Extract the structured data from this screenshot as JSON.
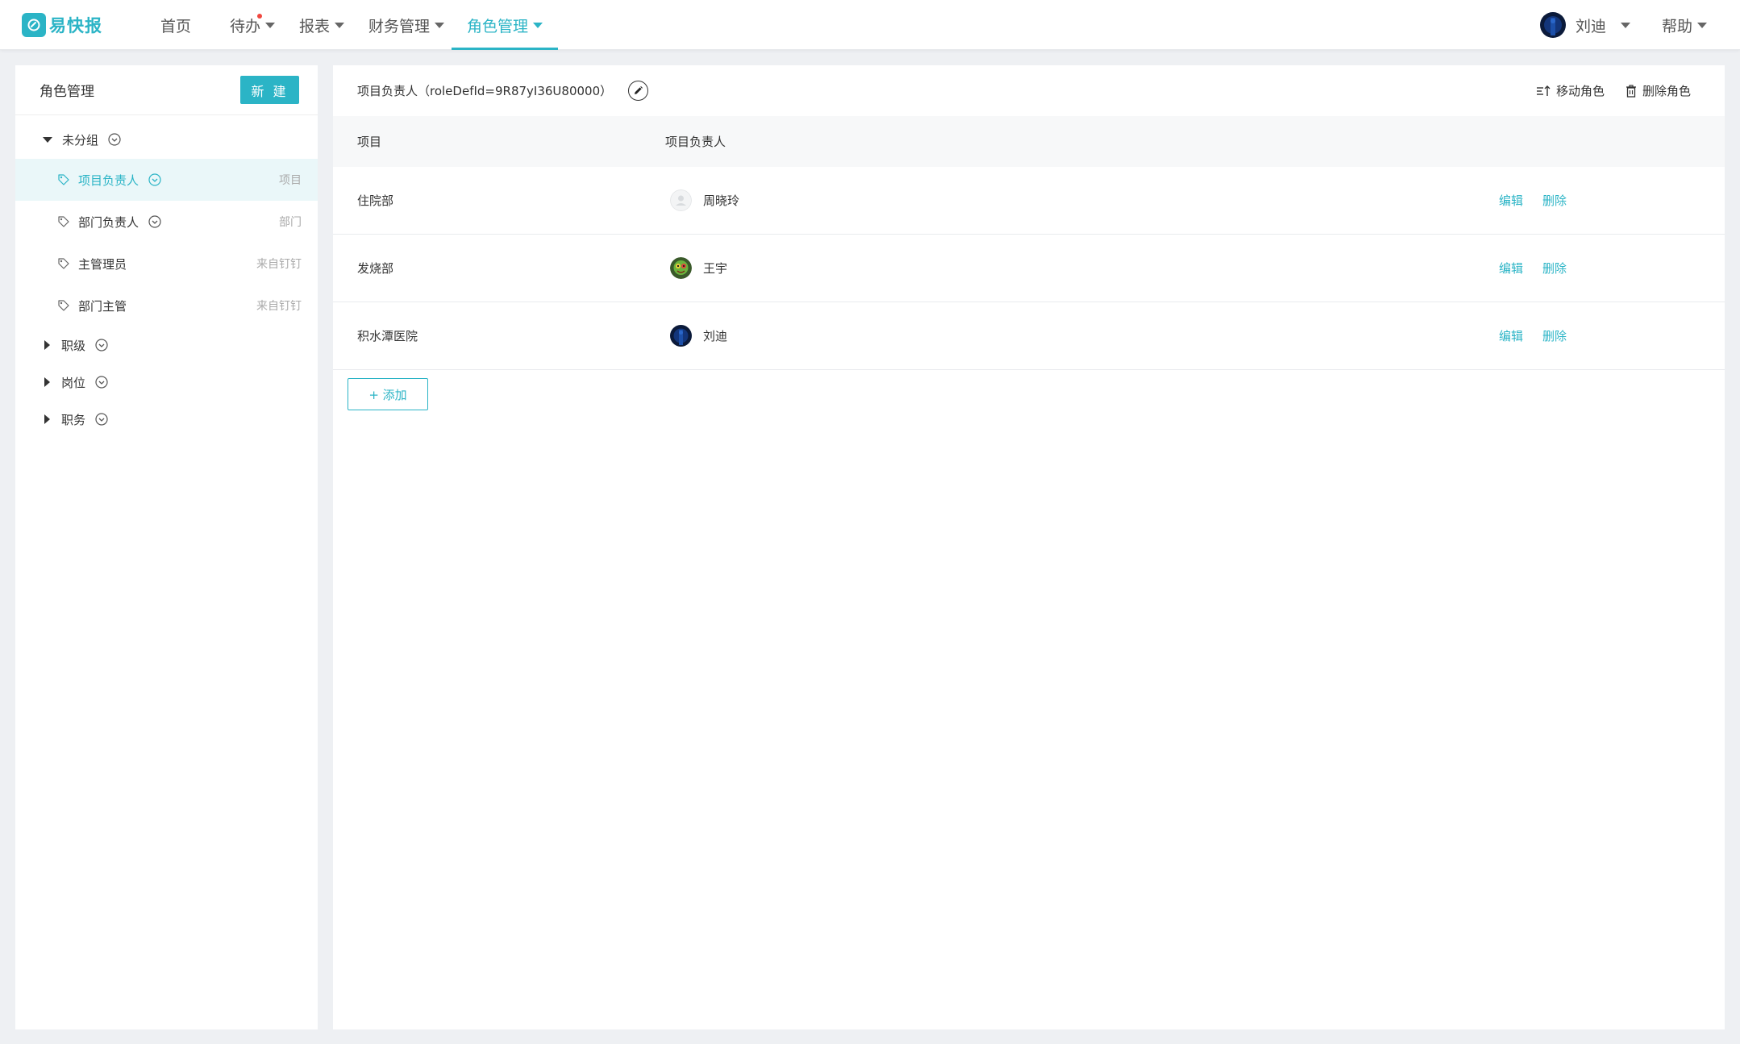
{
  "app": {
    "logo_text": "易快报"
  },
  "nav": {
    "items": [
      {
        "label": "首页"
      },
      {
        "label": "待办"
      },
      {
        "label": "报表"
      },
      {
        "label": "财务管理"
      },
      {
        "label": "角色管理"
      }
    ],
    "user_name": "刘迪",
    "help_label": "帮助"
  },
  "colors": {
    "accent": "#2bb4c6",
    "notification": "#f0473f"
  },
  "sidebar": {
    "title": "角色管理",
    "new_button": "新 建",
    "groups": [
      {
        "label": "未分组",
        "expanded": true,
        "items": [
          {
            "label": "项目负责人",
            "type": "项目",
            "selected": true,
            "has_menu": true
          },
          {
            "label": "部门负责人",
            "type": "部门",
            "selected": false,
            "has_menu": true
          },
          {
            "label": "主管理员",
            "type": "来自钉钉",
            "selected": false,
            "has_menu": false
          },
          {
            "label": "部门主管",
            "type": "来自钉钉",
            "selected": false,
            "has_menu": false
          }
        ]
      },
      {
        "label": "职级",
        "expanded": false
      },
      {
        "label": "岗位",
        "expanded": false
      },
      {
        "label": "职务",
        "expanded": false
      }
    ]
  },
  "role": {
    "title": "项目负责人（roleDefId=9R87yI36U80000）",
    "move_label": "移动角色",
    "delete_label": "删除角色"
  },
  "table": {
    "headers": [
      "项目",
      "项目负责人"
    ],
    "rows": [
      {
        "project": "住院部",
        "owner": "周晓玲",
        "avatar": "default-avatar-icon"
      },
      {
        "project": "发烧部",
        "owner": "王宇",
        "avatar": "colorful-avatar"
      },
      {
        "project": "积水潭医院",
        "owner": "刘迪",
        "avatar": "dark-blue-avatar"
      }
    ],
    "edit_label": "编辑",
    "delete_label": "删除",
    "add_button": "+ 添加"
  }
}
